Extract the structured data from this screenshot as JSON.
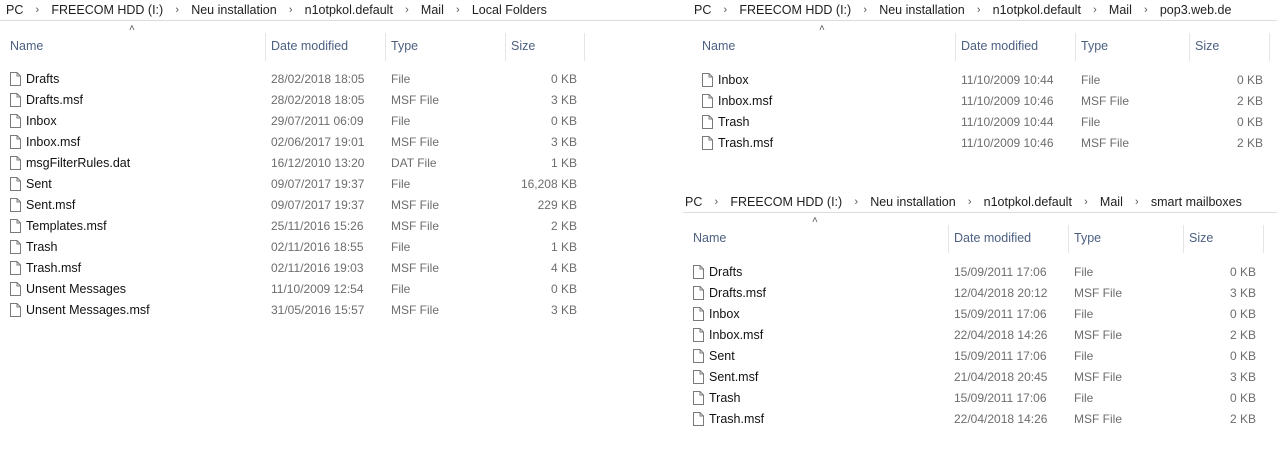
{
  "columns": {
    "name": "Name",
    "date": "Date modified",
    "type": "Type",
    "size": "Size"
  },
  "icons": {
    "file": "document-icon",
    "separator": "chevron-right-icon",
    "sort": "sort-up-icon"
  },
  "panes": [
    {
      "breadcrumb": [
        "PC",
        "FREECOM HDD (I:)",
        "Neu installation",
        "n1otpkol.default",
        "Mail",
        "Local Folders"
      ],
      "files": [
        {
          "name": "Drafts",
          "date": "28/02/2018 18:05",
          "type": "File",
          "size": "0 KB"
        },
        {
          "name": "Drafts.msf",
          "date": "28/02/2018 18:05",
          "type": "MSF File",
          "size": "3 KB"
        },
        {
          "name": "Inbox",
          "date": "29/07/2011 06:09",
          "type": "File",
          "size": "0 KB"
        },
        {
          "name": "Inbox.msf",
          "date": "02/06/2017 19:01",
          "type": "MSF File",
          "size": "3 KB"
        },
        {
          "name": "msgFilterRules.dat",
          "date": "16/12/2010 13:20",
          "type": "DAT File",
          "size": "1 KB"
        },
        {
          "name": "Sent",
          "date": "09/07/2017 19:37",
          "type": "File",
          "size": "16,208 KB"
        },
        {
          "name": "Sent.msf",
          "date": "09/07/2017 19:37",
          "type": "MSF File",
          "size": "229 KB"
        },
        {
          "name": "Templates.msf",
          "date": "25/11/2016 15:26",
          "type": "MSF File",
          "size": "2 KB"
        },
        {
          "name": "Trash",
          "date": "02/11/2016 18:55",
          "type": "File",
          "size": "1 KB"
        },
        {
          "name": "Trash.msf",
          "date": "02/11/2016 19:03",
          "type": "MSF File",
          "size": "4 KB"
        },
        {
          "name": "Unsent Messages",
          "date": "11/10/2009 12:54",
          "type": "File",
          "size": "0 KB"
        },
        {
          "name": "Unsent Messages.msf",
          "date": "31/05/2016 15:57",
          "type": "MSF File",
          "size": "3 KB"
        }
      ]
    },
    {
      "breadcrumb": [
        "PC",
        "FREECOM HDD (I:)",
        "Neu installation",
        "n1otpkol.default",
        "Mail",
        "pop3.web.de"
      ],
      "files": [
        {
          "name": "Inbox",
          "date": "11/10/2009 10:44",
          "type": "File",
          "size": "0 KB"
        },
        {
          "name": "Inbox.msf",
          "date": "11/10/2009 10:46",
          "type": "MSF File",
          "size": "2 KB"
        },
        {
          "name": "Trash",
          "date": "11/10/2009 10:44",
          "type": "File",
          "size": "0 KB"
        },
        {
          "name": "Trash.msf",
          "date": "11/10/2009 10:46",
          "type": "MSF File",
          "size": "2 KB"
        }
      ]
    },
    {
      "breadcrumb": [
        "PC",
        "FREECOM HDD (I:)",
        "Neu installation",
        "n1otpkol.default",
        "Mail",
        "smart mailboxes"
      ],
      "files": [
        {
          "name": "Drafts",
          "date": "15/09/2011 17:06",
          "type": "File",
          "size": "0 KB"
        },
        {
          "name": "Drafts.msf",
          "date": "12/04/2018 20:12",
          "type": "MSF File",
          "size": "3 KB"
        },
        {
          "name": "Inbox",
          "date": "15/09/2011 17:06",
          "type": "File",
          "size": "0 KB"
        },
        {
          "name": "Inbox.msf",
          "date": "22/04/2018 14:26",
          "type": "MSF File",
          "size": "2 KB"
        },
        {
          "name": "Sent",
          "date": "15/09/2011 17:06",
          "type": "File",
          "size": "0 KB"
        },
        {
          "name": "Sent.msf",
          "date": "21/04/2018 20:45",
          "type": "MSF File",
          "size": "3 KB"
        },
        {
          "name": "Trash",
          "date": "15/09/2011 17:06",
          "type": "File",
          "size": "0 KB"
        },
        {
          "name": "Trash.msf",
          "date": "22/04/2018 14:26",
          "type": "MSF File",
          "size": "2 KB"
        }
      ]
    }
  ]
}
